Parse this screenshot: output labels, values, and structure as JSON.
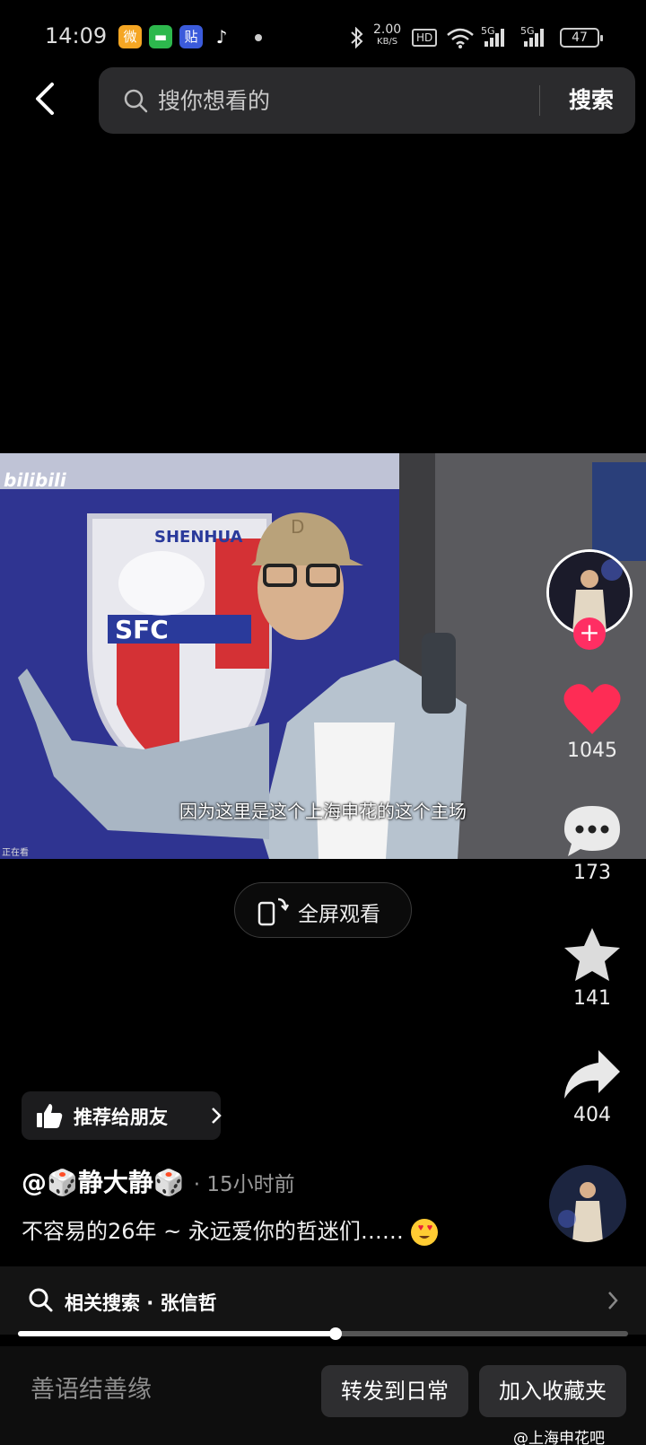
{
  "status_bar": {
    "time": "14:09",
    "net_speed_value": "2.00",
    "net_speed_unit": "KB/S",
    "hd_badge": "HD",
    "signal_1": "5G",
    "signal_2": "5G",
    "battery": "47",
    "apps": [
      {
        "icon": "weibo-icon",
        "color": "#f5a623"
      },
      {
        "icon": "message-icon",
        "color": "#2db84d"
      },
      {
        "icon": "tieba-icon",
        "color": "#3b5bdb"
      },
      {
        "icon": "tiktok-icon",
        "color": "#000000"
      }
    ]
  },
  "header": {
    "search_placeholder": "搜你想看的",
    "search_button": "搜索"
  },
  "video": {
    "watermark": "bilibili",
    "subtitle": "因为这里是这个上海申花的这个主场",
    "viewing_tag": "正在看",
    "crest_text": "SHENHUA",
    "crest_letters": "SFC",
    "cap_letter": "D"
  },
  "fullscreen_label": "全屏观看",
  "actions": {
    "likes": "1045",
    "comments": "173",
    "favorites": "141",
    "shares": "404",
    "like_color": "#fe2c55"
  },
  "recommend_label": "推荐给朋友",
  "post": {
    "author": "@🎲静大静🎲",
    "time": "· 15小时前",
    "caption": "不容易的26年 ~ 永远爱你的哲迷们……"
  },
  "related": {
    "label": "相关搜索 · 张信哲"
  },
  "progress": {
    "fraction": 0.52
  },
  "bottom": {
    "comment_placeholder": "善语结善缘",
    "share_daily": "转发到日常",
    "add_favorites": "加入收藏夹",
    "footer_watermark": "@上海申花吧"
  }
}
